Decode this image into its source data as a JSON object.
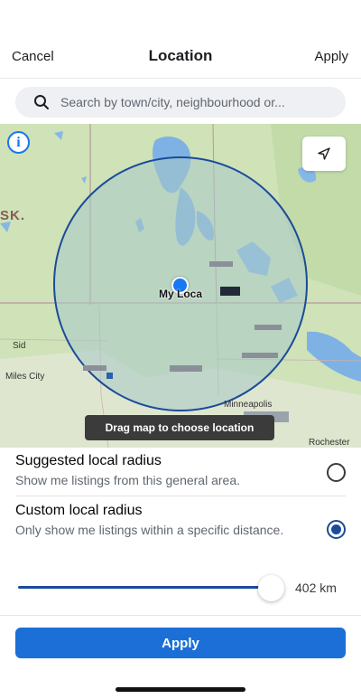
{
  "header": {
    "cancel_label": "Cancel",
    "title": "Location",
    "apply_label": "Apply"
  },
  "search": {
    "placeholder": "Search by town/city, neighbourhood or..."
  },
  "map": {
    "region_label": "SK.",
    "my_location_label": "My Loca",
    "place_labels": {
      "sid": "Sid",
      "miles_city": "Miles City",
      "minneapolis": "Minneapolis",
      "rochester": "Rochester"
    },
    "hint": "Drag map to choose location",
    "info_icon": "info-icon",
    "locate_icon": "navigation-arrow-icon",
    "radius_fill_color": "#a8c8c8",
    "radius_stroke_color": "#1b4b9a",
    "dot_color": "#1877f2"
  },
  "options": {
    "suggested": {
      "title": "Suggested local radius",
      "description": "Show me listings from this general area.",
      "selected": false
    },
    "custom": {
      "title": "Custom local radius",
      "description": "Only show me listings within a specific distance.",
      "selected": true
    }
  },
  "radius": {
    "value_label": "402 km",
    "fraction": 0.93
  },
  "footer": {
    "apply_label": "Apply",
    "accent_color": "#1b6fd6"
  }
}
